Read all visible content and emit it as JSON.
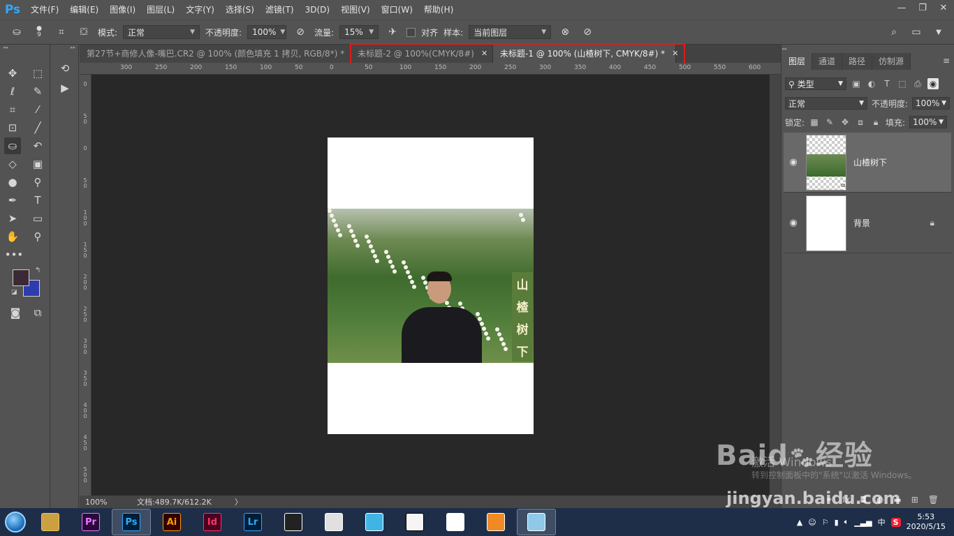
{
  "app": {
    "logo": "Ps"
  },
  "menu": [
    "文件(F)",
    "编辑(E)",
    "图像(I)",
    "图层(L)",
    "文字(Y)",
    "选择(S)",
    "滤镜(T)",
    "3D(D)",
    "视图(V)",
    "窗口(W)",
    "帮助(H)"
  ],
  "options": {
    "brush_size": "9",
    "mode_label": "模式:",
    "mode_value": "正常",
    "opacity_label": "不透明度:",
    "opacity_value": "100%",
    "flow_label": "流量:",
    "flow_value": "15%",
    "aligned_label": "对齐",
    "sample_label": "样本:",
    "sample_value": "当前图层"
  },
  "tabs": [
    {
      "label": "第27节+商修人像-嘴巴.CR2 @ 100% (颜色填充 1 拷贝, RGB/8*) *",
      "active": false
    },
    {
      "label": "未标题-2 @ 100%(CMYK/8#)",
      "active": false
    },
    {
      "label": "未标题-1 @ 100% (山楂树下, CMYK/8#) *",
      "active": true
    }
  ],
  "ruler_top": [
    "300",
    "250",
    "200",
    "150",
    "100",
    "50",
    "0",
    "50",
    "100",
    "150",
    "200",
    "250",
    "300",
    "350",
    "400",
    "450",
    "500",
    "550",
    "600"
  ],
  "ruler_left": [
    "0",
    "5 0",
    "0",
    "5 0",
    "1 0 0",
    "1 5 0",
    "2 0 0",
    "2 5 0",
    "3 0 0",
    "3 5 0",
    "4 0 0",
    "4 5 0",
    "5 0 0",
    "5"
  ],
  "photo_banner": [
    "山",
    "楂",
    "树",
    "下"
  ],
  "status": {
    "zoom": "100%",
    "doc_info": "文档:489.7K/612.2K",
    "arrow": "〉"
  },
  "panel": {
    "tabs": [
      {
        "label": "图层",
        "active": true
      },
      {
        "label": "通道",
        "active": false
      },
      {
        "label": "路径",
        "active": false
      },
      {
        "label": "仿制源",
        "active": false
      }
    ],
    "filter_label": "类型",
    "blend_mode": "正常",
    "opacity_label": "不透明度:",
    "opacity_value": "100%",
    "lock_label": "锁定:",
    "fill_label": "填充:",
    "fill_value": "100%",
    "layers": [
      {
        "name": "山楂树下",
        "selected": true,
        "locked": false
      },
      {
        "name": "背景",
        "selected": false,
        "locked": true
      }
    ]
  },
  "watermark": {
    "activate_line1": "激活 Windows",
    "activate_line2": "转到控制面板中的\"系统\"以激活 Windows。",
    "baidu": "Baid",
    "baidu_cn": "经验",
    "url": "jingyan.baidu.com"
  },
  "taskbar": {
    "apps": [
      {
        "name": "file-explorer",
        "label": "",
        "color": "#e6c35c",
        "bg": "#caa040",
        "active": false
      },
      {
        "name": "premiere",
        "label": "Pr",
        "color": "#ea77ff",
        "bg": "#2a0a3a",
        "active": false
      },
      {
        "name": "photoshop",
        "label": "Ps",
        "color": "#31a8ff",
        "bg": "#001e36",
        "active": true
      },
      {
        "name": "illustrator",
        "label": "Ai",
        "color": "#ff9a00",
        "bg": "#330000",
        "active": false
      },
      {
        "name": "indesign",
        "label": "Id",
        "color": "#ff3366",
        "bg": "#49021f",
        "active": false
      },
      {
        "name": "lightroom",
        "label": "Lr",
        "color": "#31a8ff",
        "bg": "#001e36",
        "active": false
      },
      {
        "name": "video-editor",
        "label": "",
        "color": "#ffffff",
        "bg": "#222222",
        "active": false
      },
      {
        "name": "umbrella-app",
        "label": "",
        "color": "#ffffff",
        "bg": "#e0e0e0",
        "active": false
      },
      {
        "name": "cat-app",
        "label": "",
        "color": "#ffffff",
        "bg": "#3fb5e5",
        "active": false
      },
      {
        "name": "qq",
        "label": "",
        "color": "#000000",
        "bg": "#f5f5f5",
        "active": false
      },
      {
        "name": "chrome",
        "label": "",
        "color": "#ffffff",
        "bg": "#ffffff",
        "active": false
      },
      {
        "name": "foxmail",
        "label": "",
        "color": "#ffffff",
        "bg": "#f08a24",
        "active": false
      },
      {
        "name": "notepad-app",
        "label": "",
        "color": "#ffffff",
        "bg": "#8fc8e8",
        "active": true
      }
    ],
    "ime": "中",
    "time": "5:53",
    "date": "2020/5/15"
  }
}
